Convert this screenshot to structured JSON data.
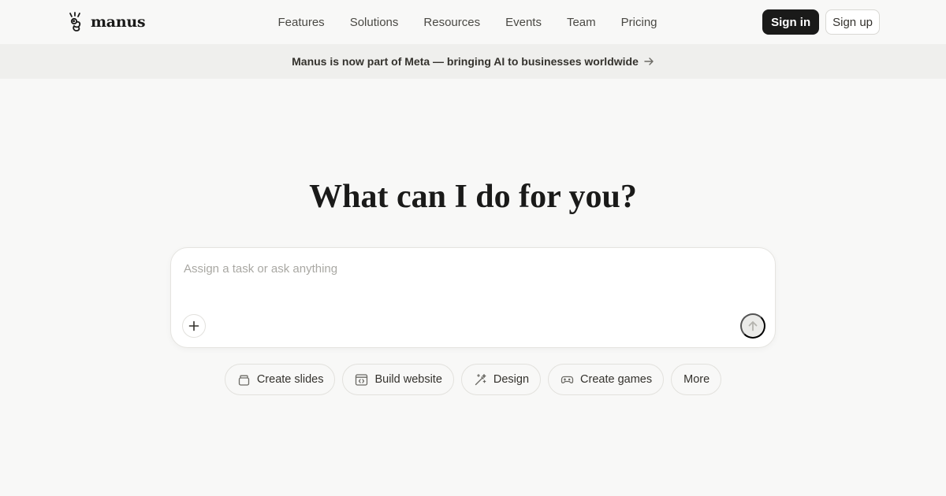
{
  "brand": {
    "name": "manus"
  },
  "nav": {
    "items": [
      {
        "label": "Features"
      },
      {
        "label": "Solutions"
      },
      {
        "label": "Resources"
      },
      {
        "label": "Events"
      },
      {
        "label": "Team"
      },
      {
        "label": "Pricing"
      }
    ]
  },
  "auth": {
    "sign_in": "Sign in",
    "sign_up": "Sign up"
  },
  "banner": {
    "text": "Manus is now part of Meta — bringing AI to businesses worldwide",
    "icon": "arrow-right-icon"
  },
  "hero": {
    "title": "What can I do for you?"
  },
  "composer": {
    "placeholder": "Assign a task or ask anything",
    "attach_icon": "plus-icon",
    "send_icon": "arrow-up-icon"
  },
  "chips": [
    {
      "label": "Create slides",
      "icon": "slides-icon"
    },
    {
      "label": "Build website",
      "icon": "code-window-icon"
    },
    {
      "label": "Design",
      "icon": "magic-wand-icon"
    },
    {
      "label": "Create games",
      "icon": "gamepad-icon"
    },
    {
      "label": "More"
    }
  ],
  "colors": {
    "background": "#f8f8f7",
    "banner_bg": "#efefed",
    "primary_button": "#1a1a19",
    "text": "#34322d"
  }
}
